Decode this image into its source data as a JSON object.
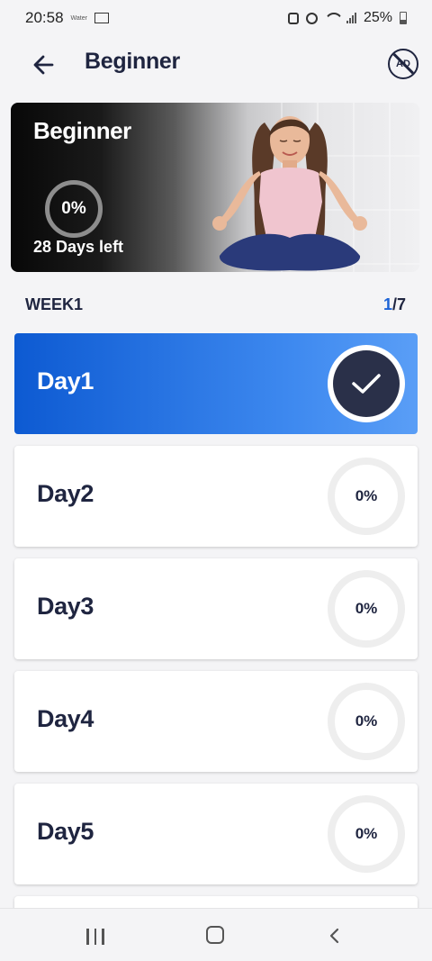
{
  "status_bar": {
    "time": "20:58",
    "small_text": "Water",
    "battery": "25%"
  },
  "header": {
    "title": "Beginner",
    "ad_label": "AD"
  },
  "banner": {
    "title": "Beginner",
    "progress": "0%",
    "days_left": "28 Days left"
  },
  "week": {
    "label": "WEEK1",
    "current": "1",
    "total": "/7"
  },
  "days": [
    {
      "label": "Day1",
      "completed": true
    },
    {
      "label": "Day2",
      "progress": "0%"
    },
    {
      "label": "Day3",
      "progress": "0%"
    },
    {
      "label": "Day4",
      "progress": "0%"
    },
    {
      "label": "Day5",
      "progress": "0%"
    }
  ],
  "colors": {
    "accent": "#1c63d6",
    "text_dark": "#1f2540",
    "check_bg": "#2a3049"
  }
}
